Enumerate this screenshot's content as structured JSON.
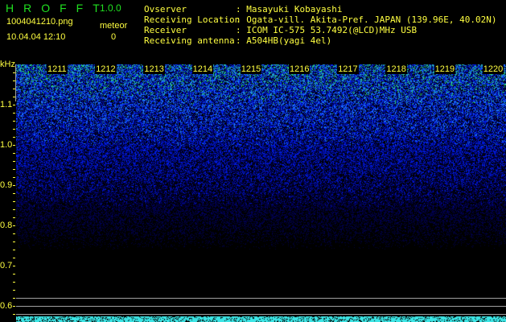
{
  "app": {
    "title": "HROFFT",
    "version": "1.0.0"
  },
  "file": {
    "name": "1004041210.png",
    "datetime": "10.04.04 12:10"
  },
  "meteor": {
    "label": "meteor",
    "count": "0"
  },
  "info": [
    {
      "label": "Ovserver",
      "value": ": Masayuki Kobayashi"
    },
    {
      "label": "Receiving Location",
      "value": ": Ogata-vill. Akita-Pref. JAPAN (139.96E, 40.02N)"
    },
    {
      "label": "Receiver",
      "value": ": ICOM IC-575 53.7492(@LCD)MHz USB"
    },
    {
      "label": "Receiving antenna",
      "value": ": A504HB(yagi 4el)"
    }
  ],
  "axis": {
    "unit": "kHz",
    "y_ticks": [
      "1.1",
      "1.0",
      "0.9",
      "0.8",
      "0.7",
      "0.6"
    ],
    "ylim": [
      0.58,
      1.2
    ],
    "time_labels": [
      "1211",
      "1212",
      "1213",
      "1214",
      "1215",
      "1216",
      "1217",
      "1218",
      "1219",
      "1220"
    ]
  },
  "colors": {
    "text": "#ffff40",
    "title": "#20e020",
    "band": "#40e0e0"
  }
}
